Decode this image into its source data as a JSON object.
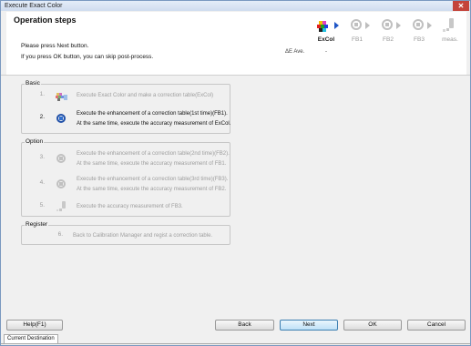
{
  "window": {
    "title": "Execute Exact Color",
    "close_glyph": "✕"
  },
  "header": {
    "title": "Operation steps",
    "instructions": [
      "Please press Next button.",
      "If you press OK button, you can skip post-process."
    ],
    "delta_e_label": "ΔE Ave.",
    "delta_e_value": "-",
    "steps": [
      {
        "label": "ExCol",
        "icon": "color-patches-icon",
        "active": true
      },
      {
        "label": "FB1",
        "icon": "refresh-cycle-icon",
        "active": false
      },
      {
        "label": "FB2",
        "icon": "refresh-cycle-icon",
        "active": false
      },
      {
        "label": "FB3",
        "icon": "refresh-cycle-icon",
        "active": false
      },
      {
        "label": "meas.",
        "icon": "measure-pen-icon",
        "active": false
      }
    ]
  },
  "groups": {
    "basic": {
      "label": "Basic",
      "steps": [
        {
          "num": "1.",
          "line1": "Execute Exact Color and make a correction table(ExCol)",
          "line2": ""
        },
        {
          "num": "2.",
          "line1": "Execute the enhancement of a correction table(1st time)(FB1).",
          "line2": "At the same time, execute the accuracy measurement of ExCol."
        }
      ]
    },
    "option": {
      "label": "Option",
      "steps": [
        {
          "num": "3.",
          "line1": "Execute the enhancement of a correction table(2nd time)(FB2).",
          "line2": "At the same time, execute the accuracy measurement of FB1."
        },
        {
          "num": "4.",
          "line1": "Execute the enhancement of a correction table(3rd time)(FB3).",
          "line2": "At the same time, execute the accuracy measurement of FB2."
        },
        {
          "num": "5.",
          "line1": "Execute the accuracy measurement of FB3.",
          "line2": ""
        }
      ]
    },
    "register": {
      "label": "Register",
      "steps": [
        {
          "num": "6.",
          "line1": "Back to Calibration Manager and regist a correction table.",
          "line2": ""
        }
      ]
    }
  },
  "buttons": {
    "help": "Help(F1)",
    "back": "Back",
    "next": "Next",
    "ok": "OK",
    "cancel": "Cancel"
  },
  "status": {
    "tab": "Current Destination"
  },
  "colors": {
    "accent": "#1f56c6",
    "disabled_text": "#9d9d9d",
    "primary_button": "#bfe1f7"
  }
}
